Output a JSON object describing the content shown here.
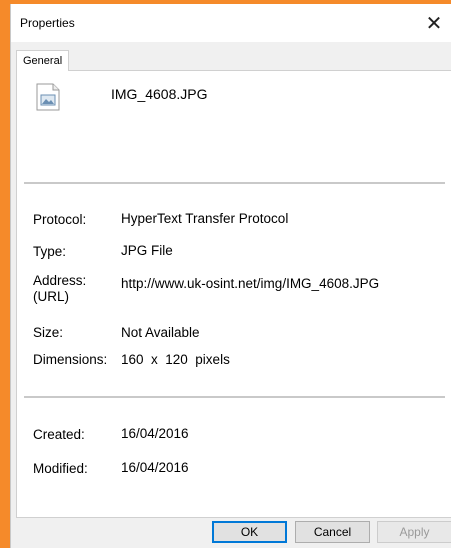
{
  "window": {
    "title": "Properties",
    "close_glyph": "✕"
  },
  "tabs": [
    {
      "label": "General",
      "selected": true
    }
  ],
  "file": {
    "icon": "image-file-icon",
    "name": "IMG_4608.JPG"
  },
  "properties": {
    "protocol": {
      "label": "Protocol:",
      "value": "HyperText Transfer Protocol"
    },
    "type": {
      "label": "Type:",
      "value": "JPG File"
    },
    "address": {
      "label_line1": "Address:",
      "label_line2": "(URL)",
      "value": "http://www.uk-osint.net/img/IMG_4608.JPG"
    },
    "size": {
      "label": "Size:",
      "value": "Not Available"
    },
    "dimensions": {
      "label": "Dimensions:",
      "value": "160  x  120  pixels"
    },
    "created": {
      "label": "Created:",
      "value": "16/04/2016"
    },
    "modified": {
      "label": "Modified:",
      "value": "16/04/2016"
    }
  },
  "buttons": {
    "ok": "OK",
    "cancel": "Cancel",
    "apply": "Apply"
  },
  "colors": {
    "background": "#f58a2a",
    "accent": "#0078d7"
  }
}
